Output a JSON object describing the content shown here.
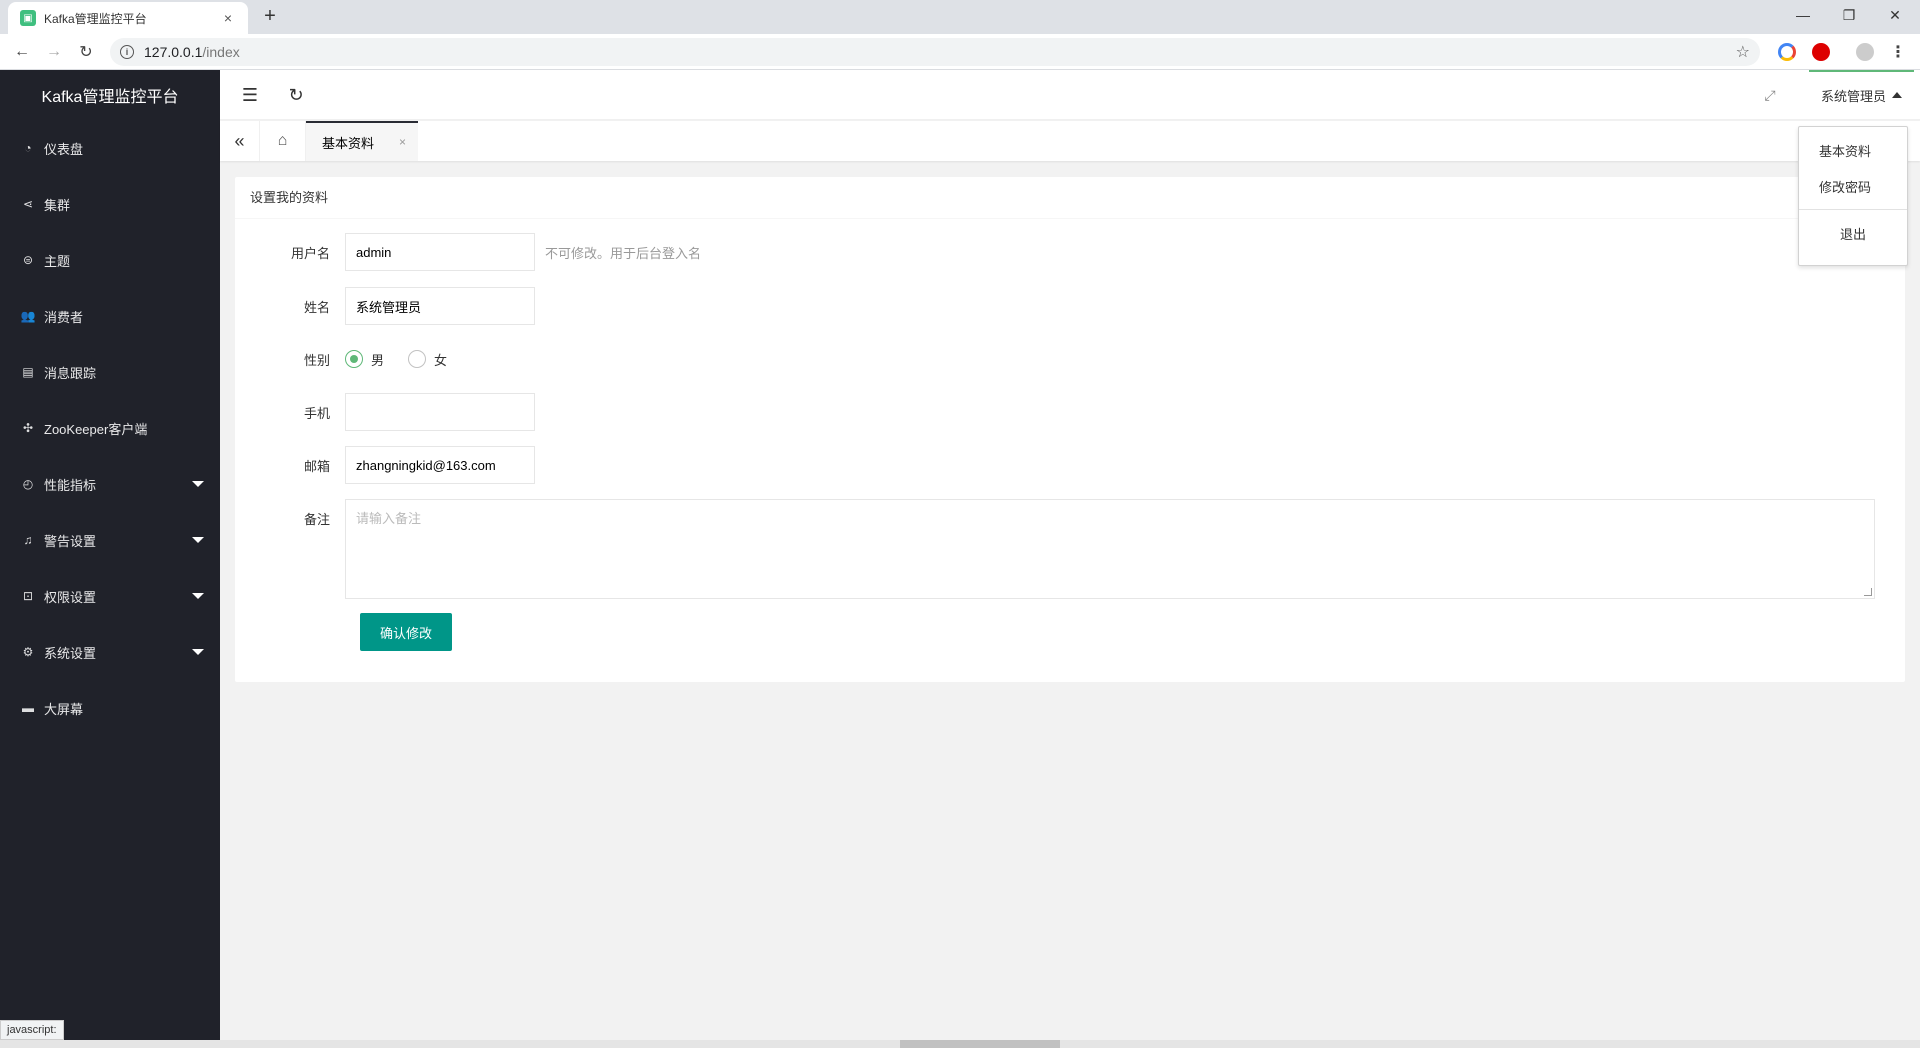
{
  "browser": {
    "tab_title": "Kafka管理监控平台",
    "tab_close": "×",
    "new_tab": "+",
    "url_host": "127.0.0.1",
    "url_path": "/index",
    "info_glyph": "i",
    "star_glyph": "☆",
    "minimize": "—",
    "maximize": "❐",
    "close": "✕",
    "back": "←",
    "forward": "→",
    "reload": "↻"
  },
  "sidebar": {
    "logo": "Kafka管理监控平台",
    "items": [
      {
        "label": "仪表盘",
        "icon": "dashboard-icon",
        "glyph": "◔",
        "has_arrow": false
      },
      {
        "label": "集群",
        "icon": "share-icon",
        "glyph": "⋖",
        "has_arrow": false
      },
      {
        "label": "主题",
        "icon": "topic-icon",
        "glyph": "⊜",
        "has_arrow": false
      },
      {
        "label": "消费者",
        "icon": "users-icon",
        "glyph": "👥",
        "has_arrow": false
      },
      {
        "label": "消息跟踪",
        "icon": "file-icon",
        "glyph": "▤",
        "has_arrow": false
      },
      {
        "label": "ZooKeeper客户端",
        "icon": "cluster-icon",
        "glyph": "✣",
        "has_arrow": false
      },
      {
        "label": "性能指标",
        "icon": "gauge-icon",
        "glyph": "◴",
        "has_arrow": true
      },
      {
        "label": "警告设置",
        "icon": "bell-icon",
        "glyph": "♫",
        "has_arrow": true
      },
      {
        "label": "权限设置",
        "icon": "lock-icon",
        "glyph": "⊡",
        "has_arrow": true
      },
      {
        "label": "系统设置",
        "icon": "gear-icon",
        "glyph": "⚙",
        "has_arrow": true
      },
      {
        "label": "大屏幕",
        "icon": "screen-icon",
        "glyph": "▬",
        "has_arrow": false
      }
    ]
  },
  "header": {
    "menu_toggle_glyph": "☰",
    "refresh_glyph": "↻",
    "fullscreen_glyph": "⤢",
    "user_name": "系统管理员"
  },
  "tabs": {
    "prev_glyph": "«",
    "home_glyph": "⌂",
    "active_label": "基本资料",
    "active_close": "×"
  },
  "form": {
    "title": "设置我的资料",
    "username_label": "用户名",
    "username_value": "admin",
    "username_hint": "不可修改。用于后台登入名",
    "name_label": "姓名",
    "name_value": "系统管理员",
    "gender_label": "性别",
    "gender_male": "男",
    "gender_female": "女",
    "gender_selected": "男",
    "phone_label": "手机",
    "phone_value": "",
    "email_label": "邮箱",
    "email_value": "zhangningkid@163.com",
    "remark_label": "备注",
    "remark_placeholder": "请输入备注",
    "submit_label": "确认修改"
  },
  "dropdown": {
    "items": [
      "基本资料",
      "修改密码"
    ],
    "logout": "退出"
  },
  "status_text": "javascript:",
  "colors": {
    "sidebar_bg": "#20222a",
    "accent_green": "#5fb878",
    "primary_button": "#009688"
  }
}
